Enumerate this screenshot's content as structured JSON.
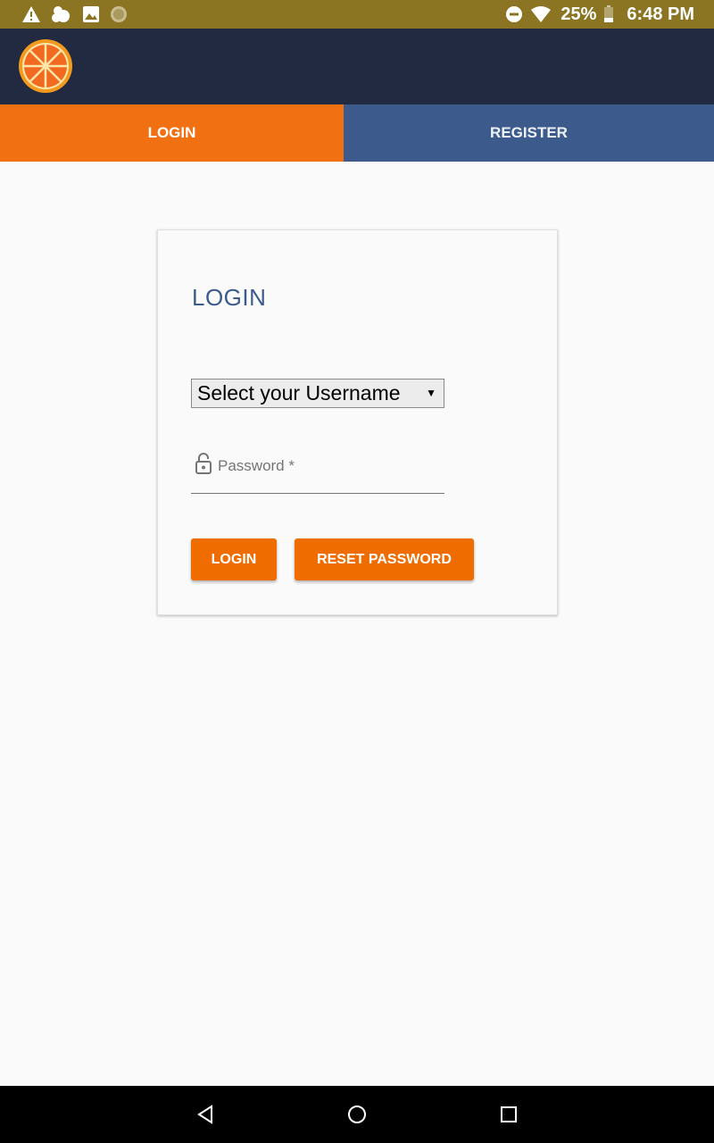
{
  "status_bar": {
    "icons": [
      "warning-icon",
      "weather-icon",
      "image-icon",
      "circle-icon",
      "do-not-disturb-icon",
      "wifi-icon",
      "battery-icon"
    ],
    "battery_percent": "25%",
    "time": "6:48 PM"
  },
  "app_bar": {
    "logo_icon": "orange-slice-logo"
  },
  "tabs": [
    {
      "label": "LOGIN",
      "active": true
    },
    {
      "label": "REGISTER",
      "active": false
    }
  ],
  "login_card": {
    "title": "LOGIN",
    "username_select": {
      "selected": "Select your Username"
    },
    "password": {
      "placeholder": "Password *",
      "value": ""
    },
    "login_button": "LOGIN",
    "reset_button": "RESET PASSWORD"
  },
  "nav_bar": {
    "icons": [
      "back-icon",
      "home-icon",
      "recents-icon"
    ]
  },
  "colors": {
    "status_bar": "#8b7523",
    "app_bar": "#222a42",
    "accent_orange": "#f07012",
    "accent_blue": "#3c5b8c"
  }
}
